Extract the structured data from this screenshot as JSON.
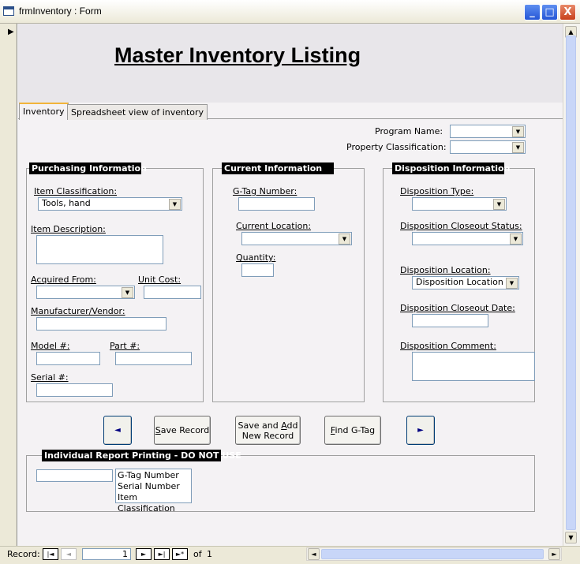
{
  "window": {
    "title": "frmInventory : Form",
    "min_label": "_",
    "max_label": "□",
    "close_label": "X"
  },
  "header": {
    "title": "Master Inventory Listing"
  },
  "tabs": [
    {
      "label": "Inventory"
    },
    {
      "label": "Spreadsheet view of inventory"
    }
  ],
  "top_fields": {
    "program_name_label": "Program Name:",
    "property_class_label": "Property Classification:",
    "program_name_value": "",
    "property_class_value": ""
  },
  "purchasing": {
    "title": "Purchasing Information",
    "item_class_label": "Item Classification:",
    "item_class_value": "Tools, hand",
    "item_desc_label": "Item Description:",
    "acquired_label": "Acquired From:",
    "unit_cost_label": "Unit Cost:",
    "manufacturer_label": "Manufacturer/Vendor:",
    "model_label": "Model #:",
    "part_label": "Part #:",
    "serial_label": "Serial #:"
  },
  "current": {
    "title": "Current Information",
    "gtag_label": "G-Tag Number:",
    "location_label": "Current Location:",
    "quantity_label": "Quantity:"
  },
  "disposition": {
    "title": "Disposition Information",
    "type_label": "Disposition Type:",
    "closeout_status_label": "Disposition Closeout Status:",
    "location_label": "Disposition Location:",
    "location_value": "Disposition Location",
    "closeout_date_label": "Disposition Closeout Date:",
    "comment_label": "Disposition Comment:"
  },
  "buttons": {
    "prev": "◄",
    "save_s": "S",
    "save_rest": "ave Record",
    "save_add_line1_a": "Save and ",
    "save_add_line1_u": "A",
    "save_add_line1_b": "dd",
    "save_add_line2": "New Record",
    "find_f": "F",
    "find_rest": "ind G-Tag",
    "next": "►"
  },
  "report": {
    "title": "Individual Report Printing - DO NOT USE",
    "options": [
      "G-Tag Number",
      "Serial Number",
      "Item Classification"
    ]
  },
  "record_nav": {
    "label": "Record:",
    "current": "1",
    "of_label": "of",
    "total": "1",
    "first": "|◄",
    "prev": "◄",
    "next": "►",
    "last": "►|",
    "new": "►*"
  }
}
